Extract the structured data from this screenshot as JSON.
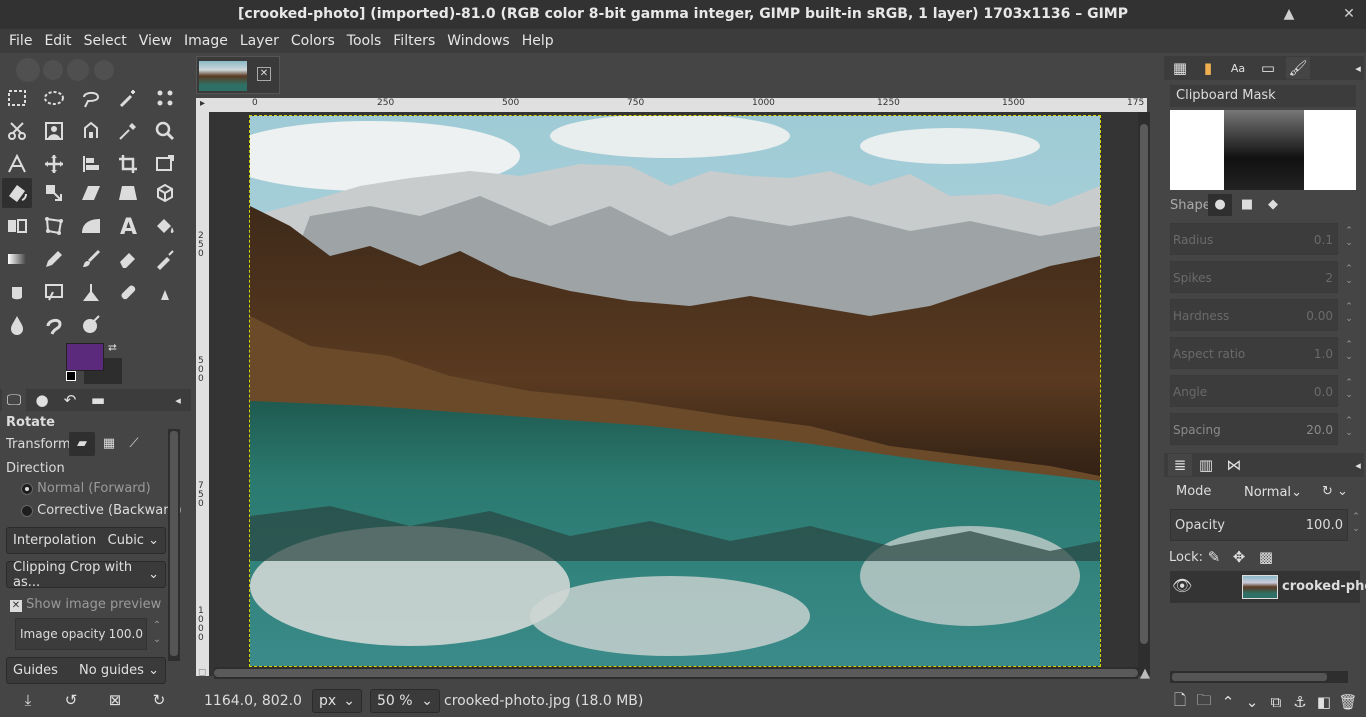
{
  "window": {
    "title": "[crooked-photo] (imported)-81.0 (RGB color 8-bit gamma integer, GIMP built-in sRGB, 1 layer) 1703x1136 – GIMP",
    "minimize": "▲",
    "close": "✕"
  },
  "menu": [
    "File",
    "Edit",
    "Select",
    "View",
    "Image",
    "Layer",
    "Colors",
    "Tools",
    "Filters",
    "Windows",
    "Help"
  ],
  "colors": {
    "foreground": "#5b2a7d",
    "background": "#2d2d2d",
    "accent": "#d4d400"
  },
  "tool_options": {
    "title": "Rotate",
    "transform_label": "Transform:",
    "direction_label": "Direction",
    "direction_normal": "Normal (Forward)",
    "direction_corrective": "Corrective (Backward)",
    "interpolation_label": "Interpolation",
    "interpolation_value": "Cubic",
    "clipping_value": "Clipping Crop with as...",
    "show_preview_label": "Show image preview",
    "image_opacity_label": "Image opacity",
    "image_opacity_value": "100.0",
    "guides_label": "Guides",
    "guides_value": "No guides"
  },
  "ruler": {
    "top": [
      "0",
      "250",
      "500",
      "750",
      "1000",
      "1250",
      "1500",
      "175"
    ],
    "left": [
      "2\n5\n0",
      "5\n0\n0",
      "7\n5\n0",
      "1\n0\n0\n0"
    ]
  },
  "status": {
    "coords": "1164.0, 802.0",
    "unit": "px",
    "zoom": "50 %",
    "file": "crooked-photo.jpg (18.0 MB)"
  },
  "brushes": {
    "name": "Clipboard Mask",
    "shape_label": "Shape:",
    "radius_label": "Radius",
    "radius_value": "0.1",
    "spikes_label": "Spikes",
    "spikes_value": "2",
    "hardness_label": "Hardness",
    "hardness_value": "0.00",
    "aspect_label": "Aspect ratio",
    "aspect_value": "1.0",
    "angle_label": "Angle",
    "angle_value": "0.0",
    "spacing_label": "Spacing",
    "spacing_value": "20.0"
  },
  "layers": {
    "mode_label": "Mode",
    "mode_value": "Normal",
    "opacity_label": "Opacity",
    "opacity_value": "100.0",
    "lock_label": "Lock:",
    "layer_name": "crooked-phot"
  }
}
